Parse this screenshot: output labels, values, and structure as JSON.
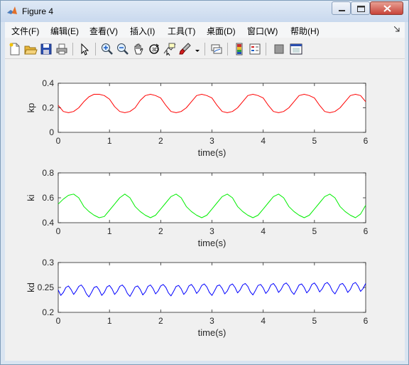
{
  "window": {
    "title": "Figure 4"
  },
  "menu": [
    {
      "label": "文件(F)"
    },
    {
      "label": "编辑(E)"
    },
    {
      "label": "查看(V)"
    },
    {
      "label": "插入(I)"
    },
    {
      "label": "工具(T)"
    },
    {
      "label": "桌面(D)"
    },
    {
      "label": "窗口(W)"
    },
    {
      "label": "帮助(H)"
    }
  ],
  "toolbar": [
    "new-figure-icon",
    "open-file-icon",
    "save-icon",
    "print-icon",
    "select-arrow-icon",
    "zoom-in-icon",
    "zoom-out-icon",
    "pan-hand-icon",
    "rotate-3d-icon",
    "data-cursor-icon",
    "brush-icon",
    "brush-dropdown-icon",
    "link-plot-icon",
    "colorbar-icon",
    "legend-icon",
    "hide-plot-tools-icon",
    "show-plot-tools-icon"
  ],
  "colors": {
    "kp": "#ff0000",
    "ki": "#00ee00",
    "kd": "#0000ff"
  },
  "chart_data": [
    {
      "type": "line",
      "xlabel": "time(s)",
      "ylabel": "kp",
      "xlim": [
        0,
        6
      ],
      "ylim": [
        0,
        0.4
      ],
      "xticks": [
        "0",
        "1",
        "2",
        "3",
        "4",
        "5",
        "6"
      ],
      "yticks": [
        "0",
        "0.2",
        "0.4"
      ],
      "grid": false,
      "series": [
        {
          "color": "#ff0000",
          "x": [
            0,
            0.1,
            0.2,
            0.3,
            0.4,
            0.5,
            0.6,
            0.7,
            0.8,
            0.9,
            1.0,
            1.1,
            1.2,
            1.3,
            1.4,
            1.5,
            1.6,
            1.7,
            1.8,
            1.9,
            2.0,
            2.1,
            2.2,
            2.3,
            2.4,
            2.5,
            2.6,
            2.7,
            2.8,
            2.9,
            3.0,
            3.1,
            3.2,
            3.3,
            3.4,
            3.5,
            3.6,
            3.7,
            3.8,
            3.9,
            4.0,
            4.1,
            4.2,
            4.3,
            4.4,
            4.5,
            4.6,
            4.7,
            4.8,
            4.9,
            5.0,
            5.1,
            5.2,
            5.3,
            5.4,
            5.5,
            5.6,
            5.7,
            5.8,
            5.9,
            6.0
          ],
          "y": [
            0.22,
            0.17,
            0.16,
            0.17,
            0.2,
            0.25,
            0.29,
            0.31,
            0.31,
            0.3,
            0.27,
            0.21,
            0.17,
            0.16,
            0.17,
            0.2,
            0.26,
            0.3,
            0.31,
            0.3,
            0.28,
            0.22,
            0.17,
            0.16,
            0.17,
            0.2,
            0.25,
            0.3,
            0.31,
            0.3,
            0.28,
            0.22,
            0.17,
            0.16,
            0.17,
            0.2,
            0.25,
            0.3,
            0.31,
            0.3,
            0.28,
            0.22,
            0.17,
            0.16,
            0.17,
            0.2,
            0.25,
            0.3,
            0.31,
            0.3,
            0.28,
            0.22,
            0.17,
            0.16,
            0.17,
            0.2,
            0.25,
            0.3,
            0.31,
            0.3,
            0.25
          ]
        }
      ]
    },
    {
      "type": "line",
      "xlabel": "time(s)",
      "ylabel": "ki",
      "xlim": [
        0,
        6
      ],
      "ylim": [
        0.4,
        0.8
      ],
      "xticks": [
        "0",
        "1",
        "2",
        "3",
        "4",
        "5",
        "6"
      ],
      "yticks": [
        "0.4",
        "0.6",
        "0.8"
      ],
      "grid": false,
      "series": [
        {
          "color": "#00ee00",
          "x": [
            0,
            0.1,
            0.2,
            0.3,
            0.4,
            0.5,
            0.6,
            0.7,
            0.8,
            0.9,
            1.0,
            1.1,
            1.2,
            1.3,
            1.4,
            1.5,
            1.6,
            1.7,
            1.8,
            1.9,
            2.0,
            2.1,
            2.2,
            2.3,
            2.4,
            2.5,
            2.6,
            2.7,
            2.8,
            2.9,
            3.0,
            3.1,
            3.2,
            3.3,
            3.4,
            3.5,
            3.6,
            3.7,
            3.8,
            3.9,
            4.0,
            4.1,
            4.2,
            4.3,
            4.4,
            4.5,
            4.6,
            4.7,
            4.8,
            4.9,
            5.0,
            5.1,
            5.2,
            5.3,
            5.4,
            5.5,
            5.6,
            5.7,
            5.8,
            5.9,
            6.0
          ],
          "y": [
            0.55,
            0.59,
            0.62,
            0.63,
            0.6,
            0.53,
            0.49,
            0.46,
            0.44,
            0.45,
            0.5,
            0.55,
            0.6,
            0.63,
            0.6,
            0.53,
            0.49,
            0.46,
            0.44,
            0.46,
            0.51,
            0.56,
            0.61,
            0.63,
            0.6,
            0.53,
            0.49,
            0.46,
            0.44,
            0.46,
            0.51,
            0.56,
            0.61,
            0.63,
            0.6,
            0.53,
            0.49,
            0.46,
            0.44,
            0.46,
            0.51,
            0.56,
            0.61,
            0.63,
            0.6,
            0.53,
            0.49,
            0.46,
            0.44,
            0.46,
            0.51,
            0.56,
            0.61,
            0.63,
            0.6,
            0.53,
            0.49,
            0.46,
            0.44,
            0.47,
            0.54
          ]
        }
      ]
    },
    {
      "type": "line",
      "xlabel": "time(s)",
      "ylabel": "kd",
      "xlim": [
        0,
        6
      ],
      "ylim": [
        0.2,
        0.3
      ],
      "xticks": [
        "0",
        "1",
        "2",
        "3",
        "4",
        "5",
        "6"
      ],
      "yticks": [
        "0.2",
        "0.25",
        "0.3"
      ],
      "grid": false,
      "series": [
        {
          "color": "#0000ff",
          "x": [
            0,
            0.05,
            0.1,
            0.15,
            0.2,
            0.25,
            0.3,
            0.35,
            0.4,
            0.45,
            0.5,
            0.55,
            0.6,
            0.65,
            0.7,
            0.75,
            0.8,
            0.85,
            0.9,
            0.95,
            1.0,
            1.05,
            1.1,
            1.15,
            1.2,
            1.25,
            1.3,
            1.35,
            1.4,
            1.45,
            1.5,
            1.55,
            1.6,
            1.65,
            1.7,
            1.75,
            1.8,
            1.85,
            1.9,
            1.95,
            2.0,
            2.05,
            2.1,
            2.15,
            2.2,
            2.25,
            2.3,
            2.35,
            2.4,
            2.45,
            2.5,
            2.55,
            2.6,
            2.65,
            2.7,
            2.75,
            2.8,
            2.85,
            2.9,
            2.95,
            3.0,
            3.05,
            3.1,
            3.15,
            3.2,
            3.25,
            3.3,
            3.35,
            3.4,
            3.45,
            3.5,
            3.55,
            3.6,
            3.65,
            3.7,
            3.75,
            3.8,
            3.85,
            3.9,
            3.95,
            4.0,
            4.05,
            4.1,
            4.15,
            4.2,
            4.25,
            4.3,
            4.35,
            4.4,
            4.45,
            4.5,
            4.55,
            4.6,
            4.65,
            4.7,
            4.75,
            4.8,
            4.85,
            4.9,
            4.95,
            5.0,
            5.05,
            5.1,
            5.15,
            5.2,
            5.25,
            5.3,
            5.35,
            5.4,
            5.45,
            5.5,
            5.55,
            5.6,
            5.65,
            5.7,
            5.75,
            5.8,
            5.85,
            5.9,
            5.95,
            6.0
          ],
          "y": [
            0.245,
            0.234,
            0.24,
            0.25,
            0.253,
            0.246,
            0.236,
            0.243,
            0.252,
            0.255,
            0.248,
            0.237,
            0.231,
            0.24,
            0.25,
            0.252,
            0.245,
            0.234,
            0.24,
            0.251,
            0.254,
            0.247,
            0.236,
            0.242,
            0.252,
            0.255,
            0.249,
            0.238,
            0.232,
            0.241,
            0.251,
            0.253,
            0.246,
            0.235,
            0.241,
            0.252,
            0.255,
            0.248,
            0.237,
            0.243,
            0.253,
            0.256,
            0.25,
            0.239,
            0.233,
            0.242,
            0.252,
            0.254,
            0.247,
            0.236,
            0.242,
            0.253,
            0.256,
            0.249,
            0.238,
            0.244,
            0.254,
            0.257,
            0.251,
            0.24,
            0.234,
            0.243,
            0.253,
            0.255,
            0.248,
            0.237,
            0.243,
            0.254,
            0.257,
            0.25,
            0.239,
            0.245,
            0.255,
            0.258,
            0.252,
            0.241,
            0.235,
            0.244,
            0.254,
            0.256,
            0.249,
            0.238,
            0.244,
            0.255,
            0.258,
            0.251,
            0.24,
            0.246,
            0.256,
            0.259,
            0.253,
            0.242,
            0.236,
            0.245,
            0.255,
            0.257,
            0.25,
            0.239,
            0.245,
            0.256,
            0.259,
            0.252,
            0.241,
            0.247,
            0.257,
            0.26,
            0.254,
            0.243,
            0.237,
            0.246,
            0.256,
            0.258,
            0.251,
            0.24,
            0.246,
            0.257,
            0.26,
            0.253,
            0.242,
            0.248,
            0.258
          ]
        }
      ]
    }
  ]
}
